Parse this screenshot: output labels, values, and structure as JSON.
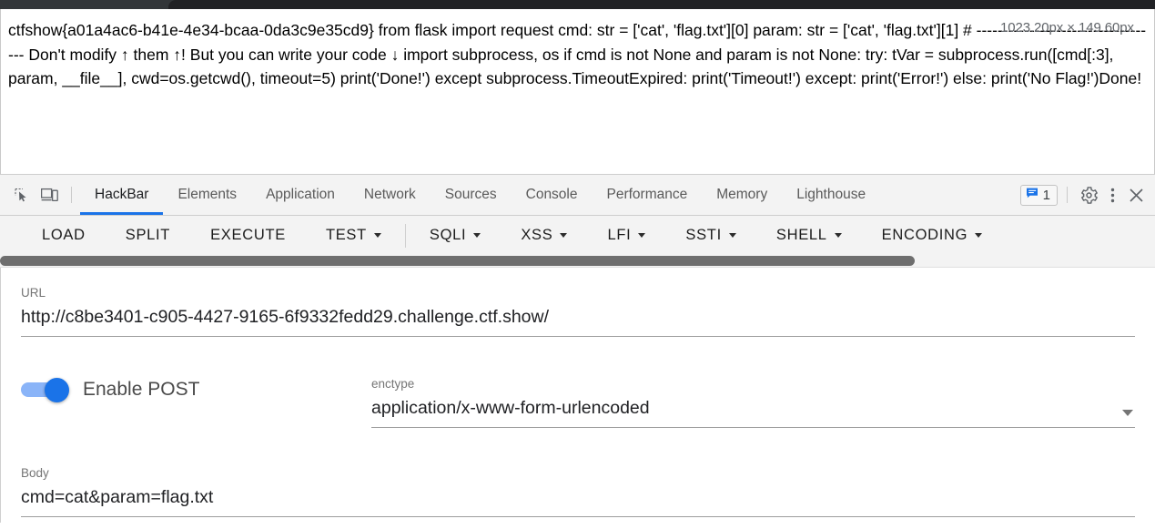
{
  "browser": {
    "chrome_strip": ""
  },
  "page": {
    "content": "ctfshow{a01a4ac6-b41e-4e34-bcaa-0da3c9e35cd9} from flask import request cmd: str = ['cat', 'flag.txt'][0] param: str = ['cat', 'flag.txt'][1] # ----------------------------------- Don't modify ↑ them ↑! But you can write your code ↓ import subprocess, os if cmd is not None and param is not None: try: tVar = subprocess.run([cmd[:3], param, __file__], cwd=os.getcwd(), timeout=5) print('Done!') except subprocess.TimeoutExpired: print('Timeout!') except: print('Error!') else: print('No Flag!')Done!",
    "dimension_tooltip": "1023.20px × 149.60px"
  },
  "devtools": {
    "icons": {
      "inspect": "inspect-element-icon",
      "device": "device-toolbar-icon",
      "settings": "gear-icon",
      "more": "more-options-icon",
      "close": "close-icon",
      "message": "message-icon"
    },
    "tabs": [
      {
        "label": "HackBar",
        "active": true
      },
      {
        "label": "Elements",
        "active": false
      },
      {
        "label": "Application",
        "active": false
      },
      {
        "label": "Network",
        "active": false
      },
      {
        "label": "Sources",
        "active": false
      },
      {
        "label": "Console",
        "active": false
      },
      {
        "label": "Performance",
        "active": false
      },
      {
        "label": "Memory",
        "active": false
      },
      {
        "label": "Lighthouse",
        "active": false
      }
    ],
    "message_count": "1",
    "active_tab_accent": "#1a73e8"
  },
  "hackbar": {
    "toolbar": [
      {
        "label": "LOAD",
        "dropdown": false,
        "separator_after": false
      },
      {
        "label": "SPLIT",
        "dropdown": false,
        "separator_after": false
      },
      {
        "label": "EXECUTE",
        "dropdown": false,
        "separator_after": false
      },
      {
        "label": "TEST",
        "dropdown": true,
        "separator_after": true
      },
      {
        "label": "SQLI",
        "dropdown": true,
        "separator_after": false
      },
      {
        "label": "XSS",
        "dropdown": true,
        "separator_after": false
      },
      {
        "label": "LFI",
        "dropdown": true,
        "separator_after": false
      },
      {
        "label": "SSTI",
        "dropdown": true,
        "separator_after": false
      },
      {
        "label": "SHELL",
        "dropdown": true,
        "separator_after": false
      },
      {
        "label": "ENCODING",
        "dropdown": true,
        "separator_after": false
      }
    ],
    "url": {
      "label": "URL",
      "value": "http://c8be3401-c905-4427-9165-6f9332fedd29.challenge.ctf.show/"
    },
    "post": {
      "toggle_label": "Enable POST",
      "enabled": true,
      "toggle_color": "#1a73e8"
    },
    "enctype": {
      "label": "enctype",
      "value": "application/x-www-form-urlencoded"
    },
    "body": {
      "label": "Body",
      "value": "cmd=cat&param=flag.txt"
    }
  }
}
